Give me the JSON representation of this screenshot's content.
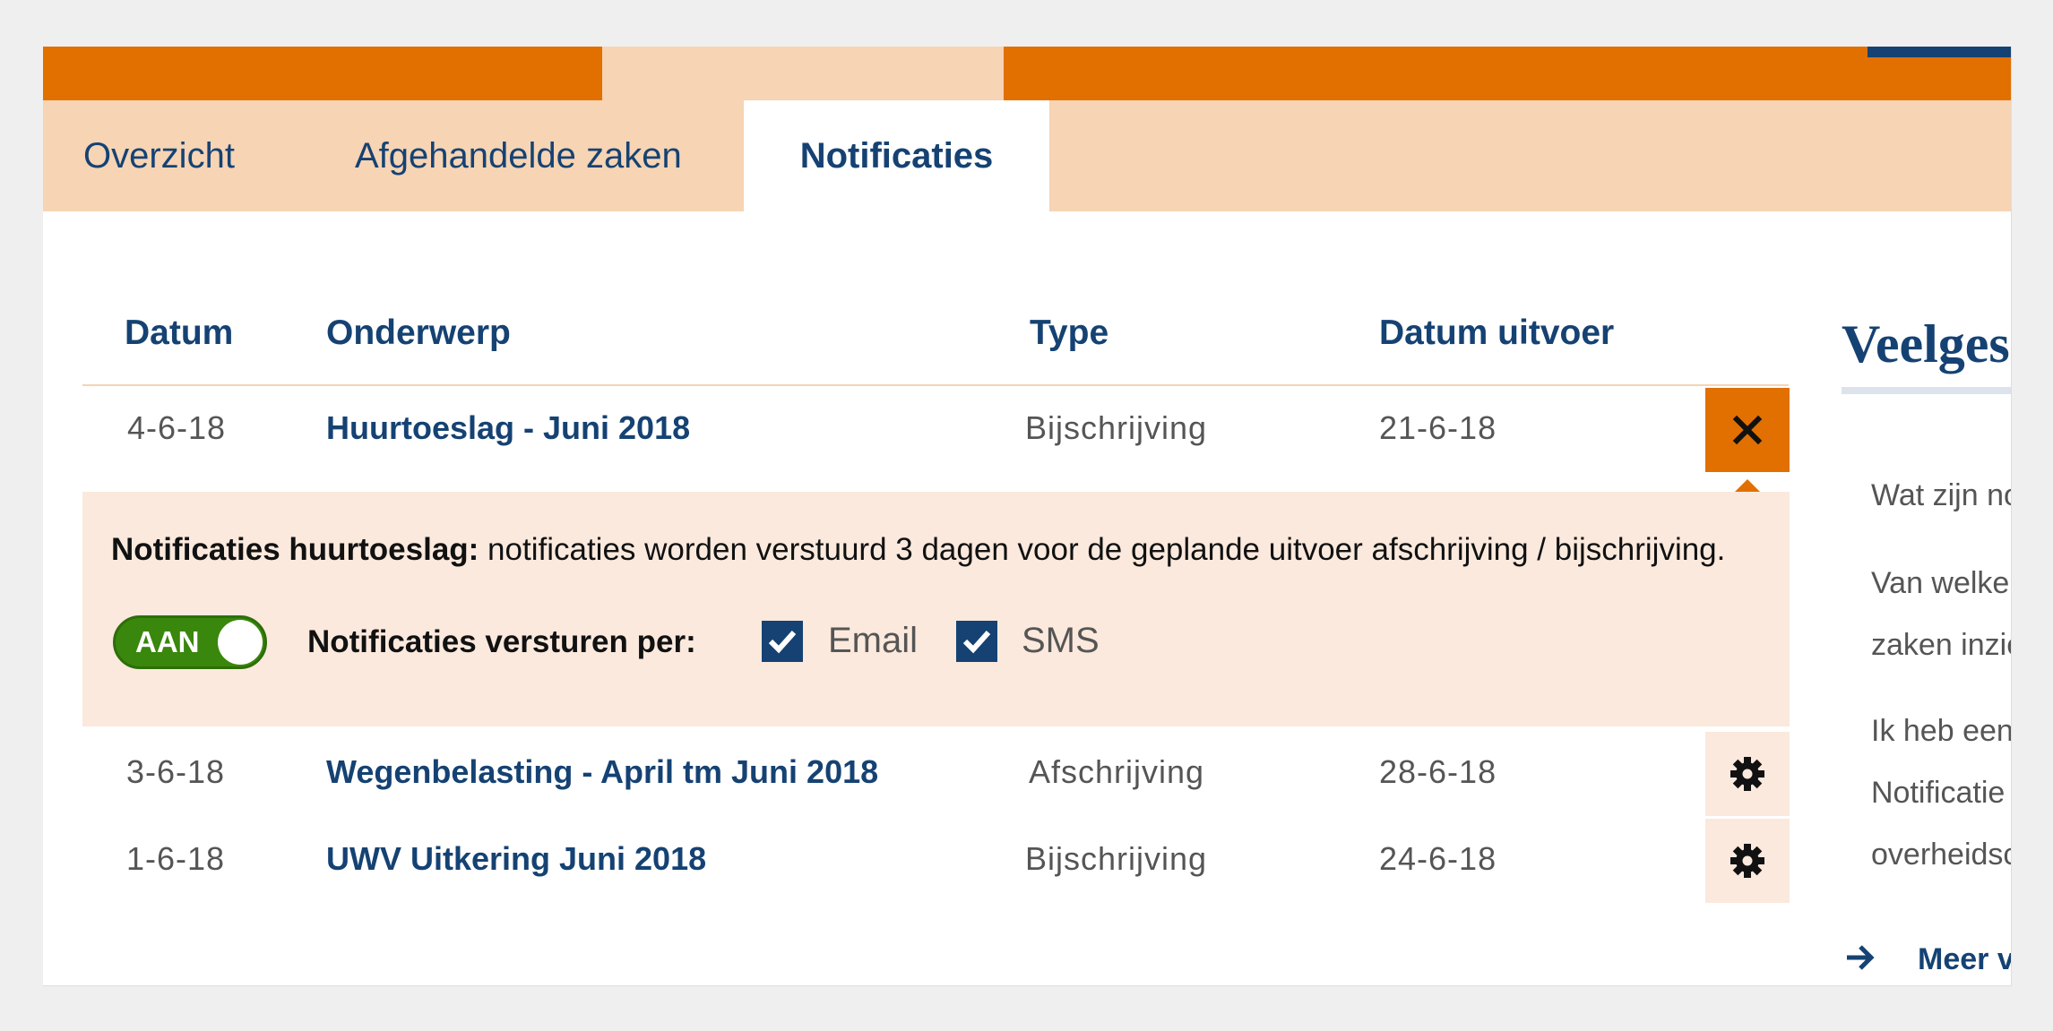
{
  "tabs": [
    {
      "label": "Overzicht"
    },
    {
      "label": "Afgehandelde zaken"
    },
    {
      "label": "Notificaties"
    }
  ],
  "table": {
    "headers": [
      "Datum",
      "Onderwerp",
      "Type",
      "Datum uitvoer"
    ],
    "rows": [
      {
        "datum": "4-6-18",
        "onderwerp": "Huurtoeslag - Juni 2018",
        "type": "Bijschrijving",
        "uitvoer": "21-6-18",
        "action": "close-icon"
      },
      {
        "datum": "3-6-18",
        "onderwerp": "Wegenbelasting - April tm Juni 2018",
        "type": "Afschrijving",
        "uitvoer": "28-6-18",
        "action": "gear-icon"
      },
      {
        "datum": "1-6-18",
        "onderwerp": "UWV Uitkering Juni 2018",
        "type": "Bijschrijving",
        "uitvoer": "24-6-18",
        "action": "gear-icon"
      }
    ]
  },
  "panel": {
    "title": "Notificaties huurtoeslag:",
    "text": " notificaties worden verstuurd 3 dagen voor de geplande uitvoer afschrijving / bijschrijving.",
    "toggle_label": "AAN",
    "toggle_on": true,
    "send_label": "Notificaties versturen per:",
    "options": [
      {
        "label": "Email",
        "checked": true
      },
      {
        "label": "SMS",
        "checked": true
      }
    ]
  },
  "sidebar": {
    "title": "Veelges",
    "lines": [
      "Wat zijn no",
      "Van welke",
      "zaken inzie",
      "Ik heb een",
      "Notificatie",
      "overheidsc"
    ],
    "link": "Meer v"
  },
  "colors": {
    "orange": "#e17000",
    "peach": "#f6d4b4",
    "light_peach": "#fbe9dd",
    "navy": "#154273",
    "green": "#39870c"
  }
}
